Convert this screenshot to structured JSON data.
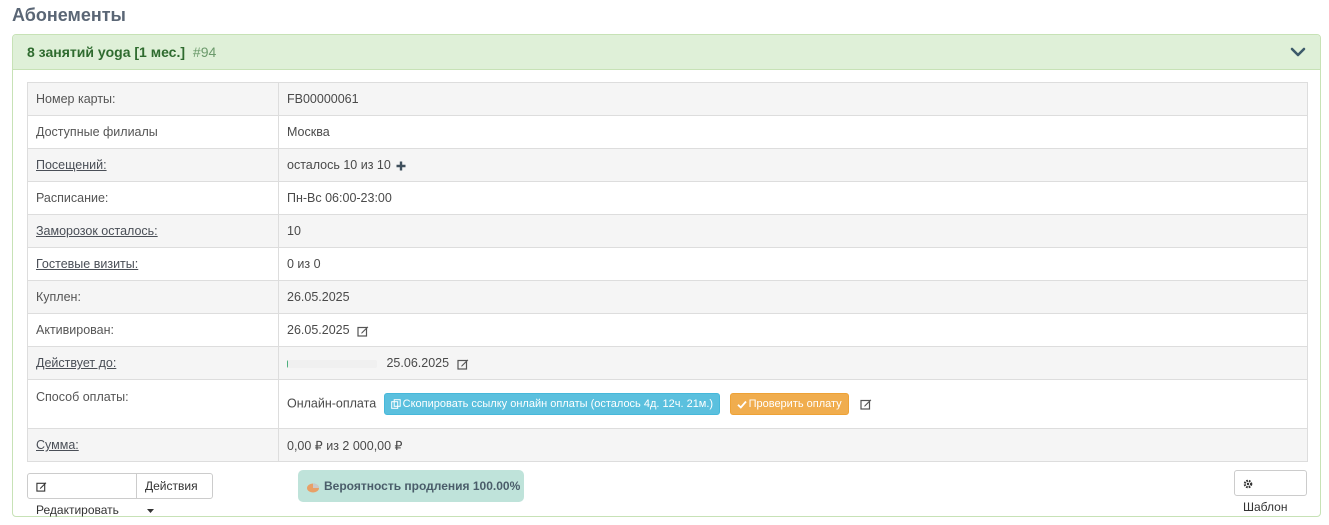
{
  "page": {
    "title": "Абонементы"
  },
  "panel": {
    "title": "8 занятий yoga [1 мес.]",
    "id": "#94",
    "chevron_icon": "chevron-down-icon"
  },
  "rows": {
    "card": {
      "label": "Номер карты:",
      "value": "FB00000061"
    },
    "branches": {
      "label": "Доступные филиалы",
      "value": "Москва"
    },
    "visits": {
      "label": "Посещений:",
      "value": "осталось 10 из 10"
    },
    "schedule": {
      "label": "Расписание:",
      "value": "Пн-Вс 06:00-23:00"
    },
    "freezes": {
      "label": "Заморозок осталось:",
      "value": "10"
    },
    "guests": {
      "label": "Гостевые визиты:",
      "value": "0 из 0"
    },
    "bought": {
      "label": "Куплен:",
      "value": "26.05.2025"
    },
    "activated": {
      "label": "Активирован:",
      "value": "26.05.2025"
    },
    "valid": {
      "label": "Действует до:",
      "value": "25.06.2025",
      "progress_fraction": 0.01
    },
    "payment": {
      "label": "Способ оплаты:",
      "value": "Онлайн-оплата",
      "copy_link": "Скопировать ссылку онлайн оплаты (осталось 4д. 12ч. 21м.)",
      "check": "Проверить оплату"
    },
    "sum": {
      "label": "Сумма:",
      "value": "0,00 ₽ из 2 000,00 ₽"
    }
  },
  "footer": {
    "edit": "Редактировать",
    "actions": "Действия",
    "probability": "Вероятность продления 100.00%",
    "template": "Шаблон"
  },
  "colors": {
    "header_bg": "#dff0d8",
    "info_button": "#5bc0de",
    "warning_button": "#f0ad4e",
    "sum_red": "#d9312b",
    "probability_bg": "#bfe3da"
  }
}
